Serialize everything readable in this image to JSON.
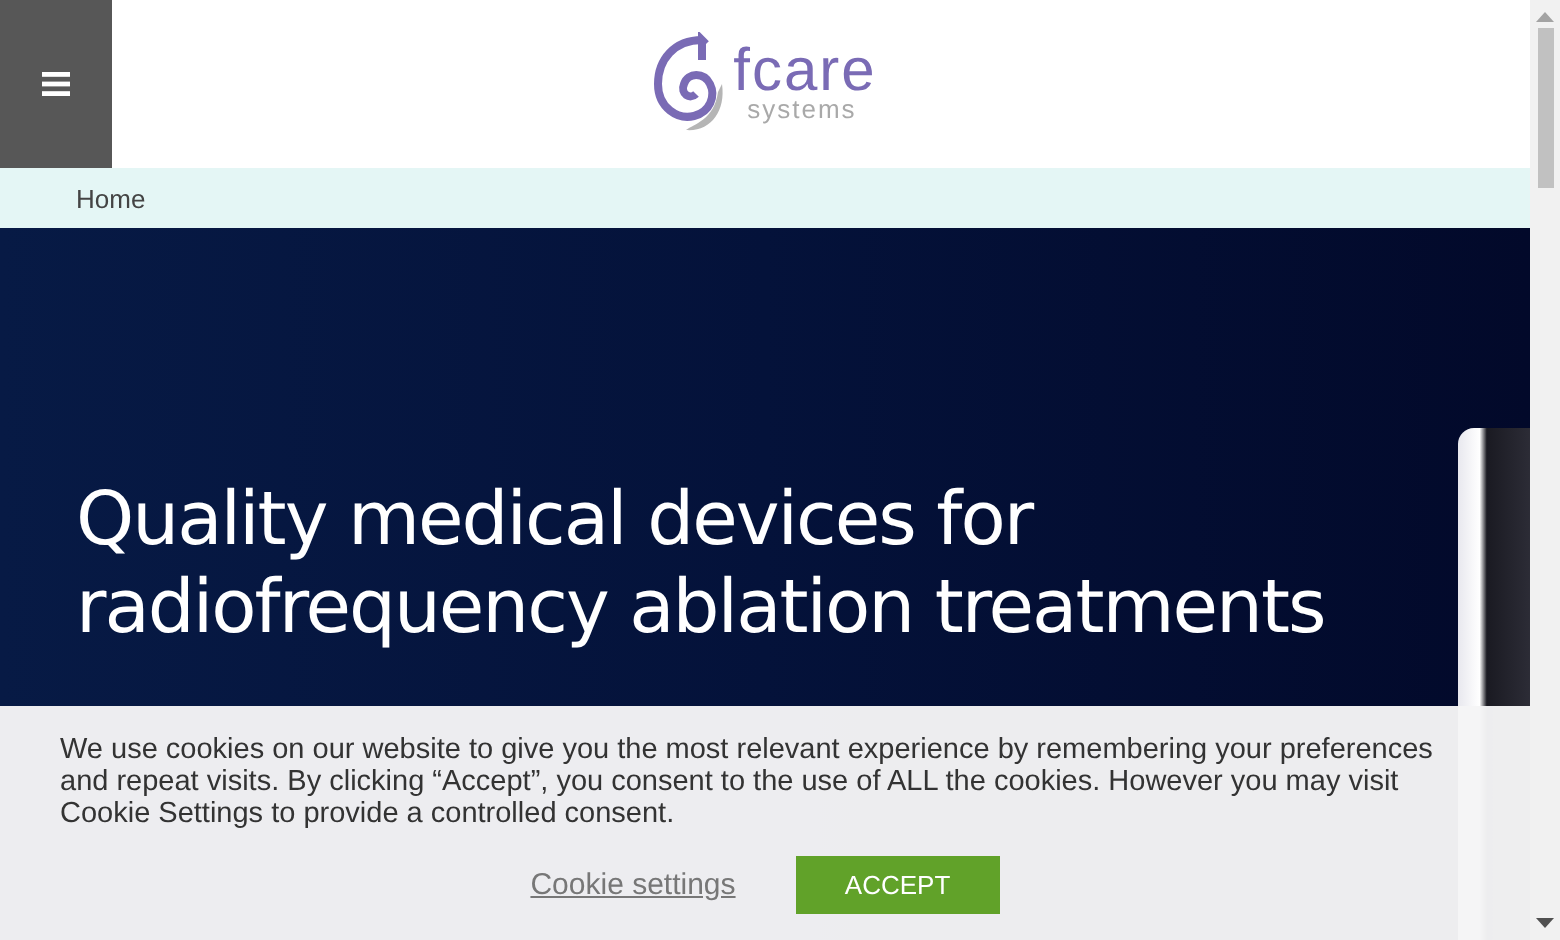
{
  "header": {
    "logo": {
      "name": "fcare",
      "tagline": "systems"
    }
  },
  "breadcrumb": [
    "Home"
  ],
  "hero": {
    "title": "Quality medical devices for radiofrequency ablation treatments"
  },
  "cookie_banner": {
    "text": "We use cookies on our website to give you the most relevant experience by remembering your preferences and repeat visits. By clicking “Accept”, you consent to the use of ALL the cookies. However you may visit Cookie Settings to provide a controlled consent.",
    "settings_link": "Cookie settings",
    "accept_button": "ACCEPT"
  }
}
